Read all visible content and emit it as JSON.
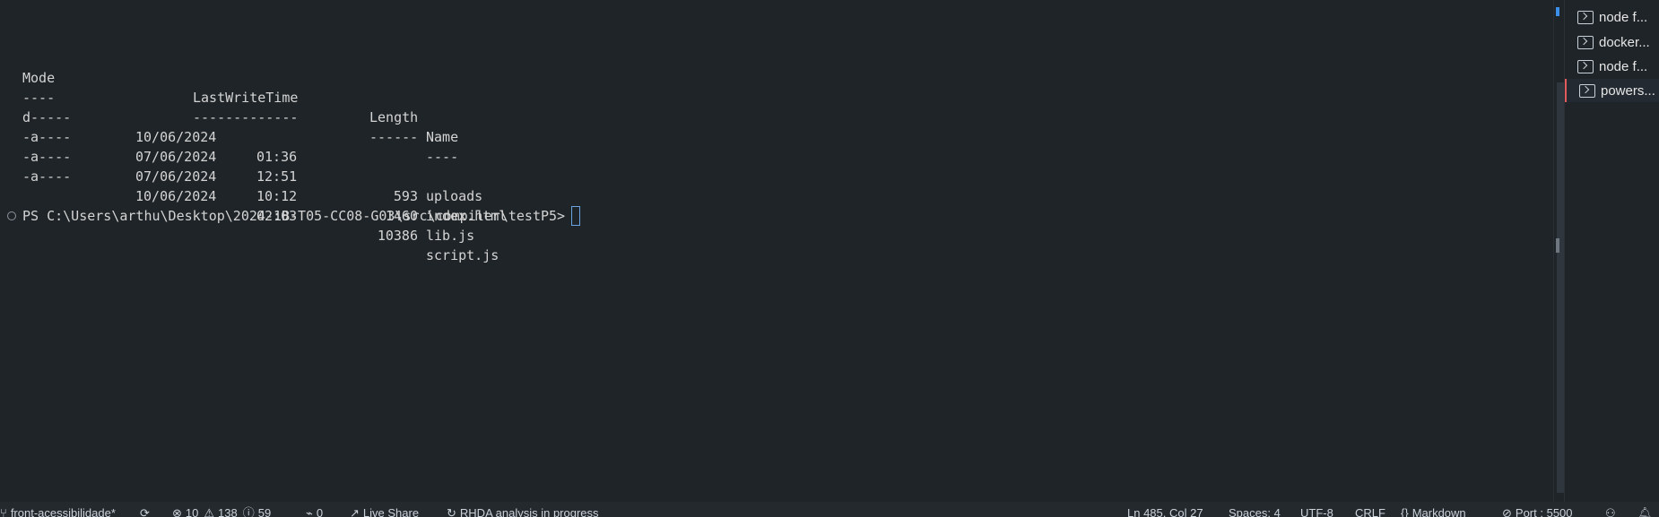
{
  "terminal": {
    "header": {
      "mode": "Mode",
      "time": "LastWriteTime",
      "length": "Length",
      "name": "Name"
    },
    "divider": {
      "mode": "----",
      "time": "-------------",
      "length": "------",
      "name": "----"
    },
    "rows": [
      {
        "mode": "d-----",
        "date": "10/06/2024",
        "time": "01:36",
        "length": "",
        "name": "uploads"
      },
      {
        "mode": "-a----",
        "date": "07/06/2024",
        "time": "12:51",
        "length": "593",
        "name": "index.html"
      },
      {
        "mode": "-a----",
        "date": "07/06/2024",
        "time": "10:12",
        "length": "1460",
        "name": "lib.js"
      },
      {
        "mode": "-a----",
        "date": "10/06/2024",
        "time": "02:03",
        "length": "10386",
        "name": "script.js"
      }
    ],
    "prompt": "PS C:\\Users\\arthu\\Desktop\\2024-1B-T05-CC08-G03\\src\\compiler\\testP5>"
  },
  "tabs": [
    {
      "label": "node  f..."
    },
    {
      "label": "docker..."
    },
    {
      "label": "node  f..."
    },
    {
      "label": "powers..."
    }
  ],
  "statusbar": {
    "branch": "front-acessibilidade*",
    "errors": "10",
    "warnings": "138",
    "infos": "59",
    "ports_count": "0",
    "live_share": "Live Share",
    "rhda": "RHDA analysis in progress",
    "position": "Ln 485, Col 27",
    "spaces": "Spaces: 4",
    "encoding": "UTF-8",
    "eol": "CRLF",
    "language": "Markdown",
    "port": "Port : 5500"
  },
  "colors": {
    "background": "#1f2428",
    "cursor": "#6aa3e0",
    "active_tab_marker": "#e35a5a"
  }
}
